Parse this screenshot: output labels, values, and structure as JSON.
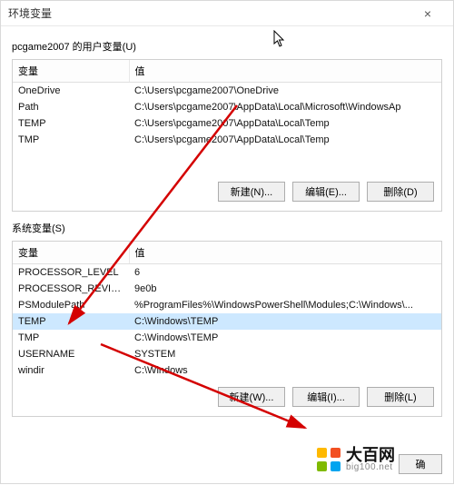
{
  "window": {
    "title": "环境变量",
    "close": "×"
  },
  "user_section": {
    "label": "pcgame2007 的用户变量(U)",
    "col_name": "变量",
    "col_value": "值",
    "rows": [
      {
        "name": "OneDrive",
        "value": "C:\\Users\\pcgame2007\\OneDrive"
      },
      {
        "name": "Path",
        "value": "C:\\Users\\pcgame2007\\AppData\\Local\\Microsoft\\WindowsAp"
      },
      {
        "name": "TEMP",
        "value": "C:\\Users\\pcgame2007\\AppData\\Local\\Temp"
      },
      {
        "name": "TMP",
        "value": "C:\\Users\\pcgame2007\\AppData\\Local\\Temp"
      }
    ],
    "buttons": {
      "new": "新建(N)...",
      "edit": "编辑(E)...",
      "delete": "删除(D)"
    }
  },
  "sys_section": {
    "label": "系统变量(S)",
    "col_name": "变量",
    "col_value": "值",
    "rows": [
      {
        "name": "PROCESSOR_LEVEL",
        "value": "6"
      },
      {
        "name": "PROCESSOR_REVISION",
        "value": "9e0b"
      },
      {
        "name": "PSModulePath",
        "value": "%ProgramFiles%\\WindowsPowerShell\\Modules;C:\\Windows\\..."
      },
      {
        "name": "TEMP",
        "value": "C:\\Windows\\TEMP"
      },
      {
        "name": "TMP",
        "value": "C:\\Windows\\TEMP"
      },
      {
        "name": "USERNAME",
        "value": "SYSTEM"
      },
      {
        "name": "windir",
        "value": "C:\\Windows"
      }
    ],
    "selected_index": 3,
    "buttons": {
      "new": "新建(W)...",
      "edit": "编辑(I)...",
      "delete": "删除(L)"
    }
  },
  "footer": {
    "ok": "确"
  },
  "watermark": {
    "brand": "大百网",
    "url": "big100.net"
  }
}
